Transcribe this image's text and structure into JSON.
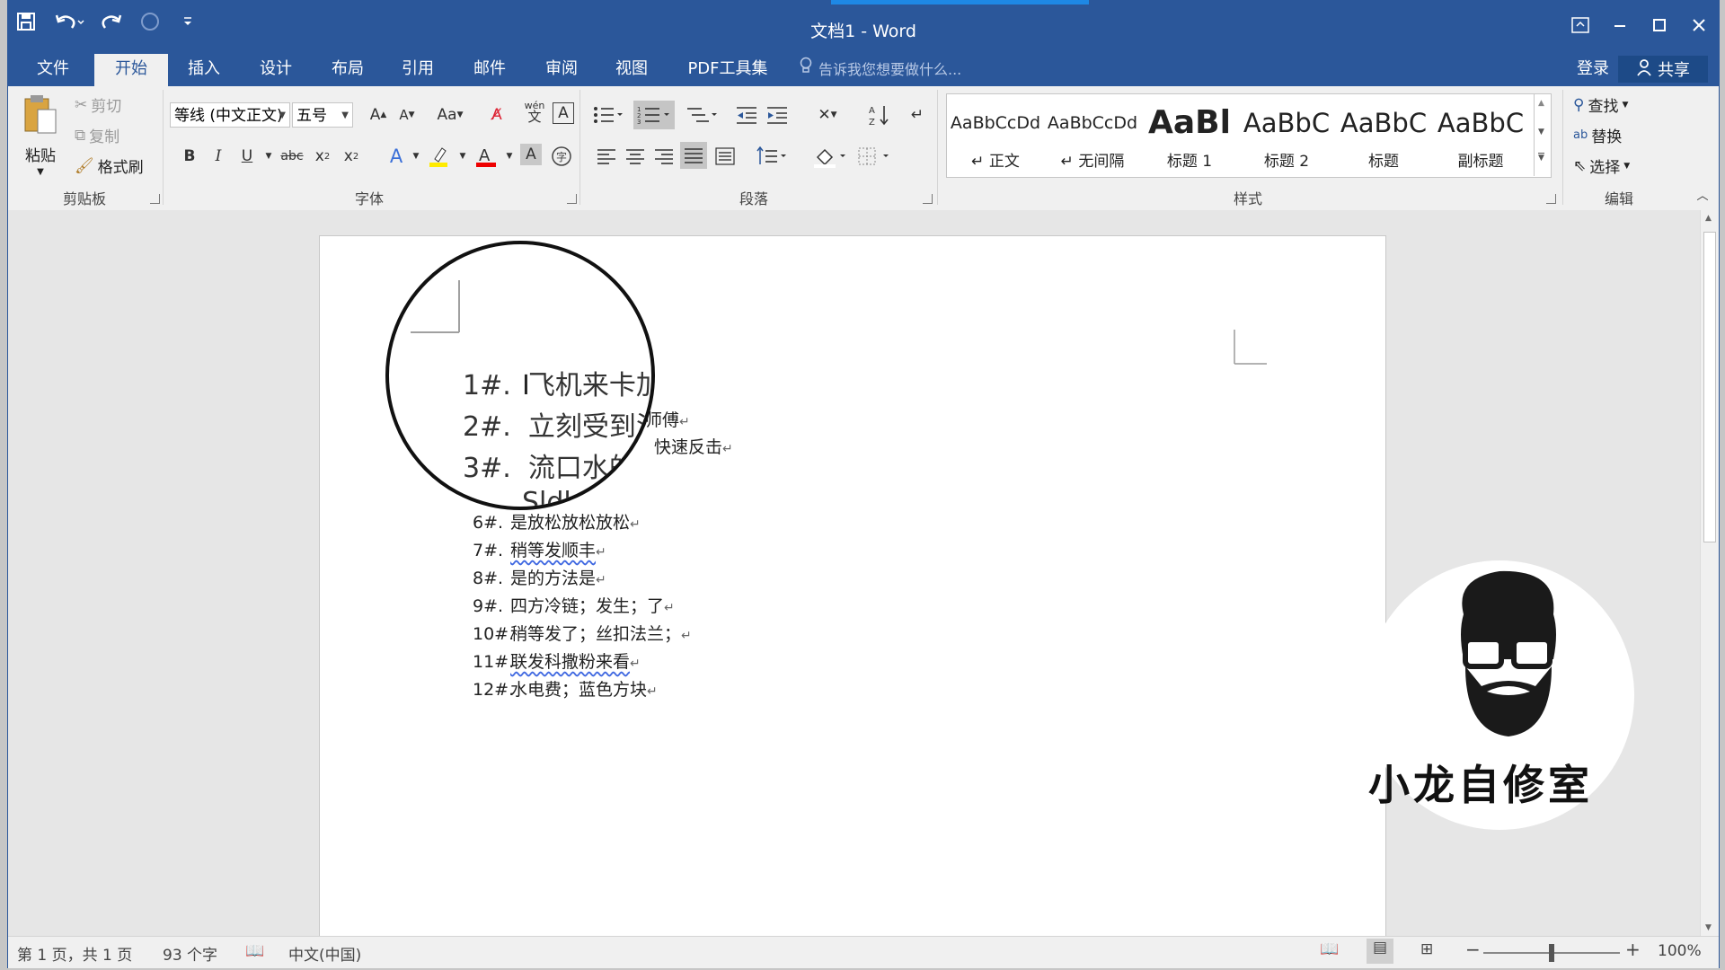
{
  "window": {
    "title": "文档1 - Word"
  },
  "quick_access": {
    "icons": [
      "save-icon",
      "undo-icon",
      "redo-icon",
      "circle-icon",
      "customize-icon"
    ]
  },
  "tabs": [
    {
      "label": "文件"
    },
    {
      "label": "开始"
    },
    {
      "label": "插入"
    },
    {
      "label": "设计"
    },
    {
      "label": "布局"
    },
    {
      "label": "引用"
    },
    {
      "label": "邮件"
    },
    {
      "label": "审阅"
    },
    {
      "label": "视图"
    },
    {
      "label": "PDF工具集"
    }
  ],
  "tell_me": "告诉我您想要做什么...",
  "account": {
    "login": "登录",
    "share": "共享"
  },
  "ribbon": {
    "clipboard": {
      "label": "剪贴板",
      "paste": "粘贴",
      "cut": "剪切",
      "copy": "复制",
      "format_painter": "格式刷"
    },
    "font": {
      "label": "字体",
      "font_name": "等线 (中文正文)",
      "font_size": "五号",
      "wen": "wén",
      "wen_char": "文"
    },
    "paragraph": {
      "label": "段落"
    },
    "styles": {
      "label": "样式",
      "items": [
        {
          "sample": "AaBbCcDd",
          "name": "↵ 正文"
        },
        {
          "sample": "AaBbCcDd",
          "name": "↵ 无间隔"
        },
        {
          "sample": "AaBl",
          "name": "标题 1"
        },
        {
          "sample": "AaBbC",
          "name": "标题 2"
        },
        {
          "sample": "AaBbC",
          "name": "标题"
        },
        {
          "sample": "AaBbC",
          "name": "副标题"
        }
      ]
    },
    "editing": {
      "label": "编辑",
      "find": "查找",
      "replace": "替换",
      "select": "选择"
    }
  },
  "document": {
    "lines": [
      {
        "num": "6#.",
        "text": "是放松放松放松"
      },
      {
        "num": "7#.",
        "text": "稍等发顺丰"
      },
      {
        "num": "8#.",
        "text": "是的方法是"
      },
      {
        "num": "9#.",
        "text": "四方冷链；发生；了"
      },
      {
        "num": "10#.",
        "text": "稍等发了；丝扣法兰；"
      },
      {
        "num": "11#.",
        "text": "联发科撒粉来看"
      },
      {
        "num": "12#.",
        "text": "水电费；蓝色方块"
      }
    ],
    "partial_lines": [
      {
        "text": "师傅"
      },
      {
        "text": "快速反击"
      }
    ],
    "magnified": [
      {
        "num": "1#.",
        "text": "飞机来卡加"
      },
      {
        "num": "2#.",
        "text": "立刻受到法"
      },
      {
        "num": "3#.",
        "text": "流口水的"
      },
      {
        "num": "",
        "text": "Sldl"
      }
    ],
    "paragraph_mark": "↵"
  },
  "watermark": {
    "text": "小龙自修室"
  },
  "status": {
    "page": "第 1 页，共 1 页",
    "words": "93 个字",
    "language": "中文(中国)",
    "zoom": "100%"
  },
  "zoom_level": 100
}
